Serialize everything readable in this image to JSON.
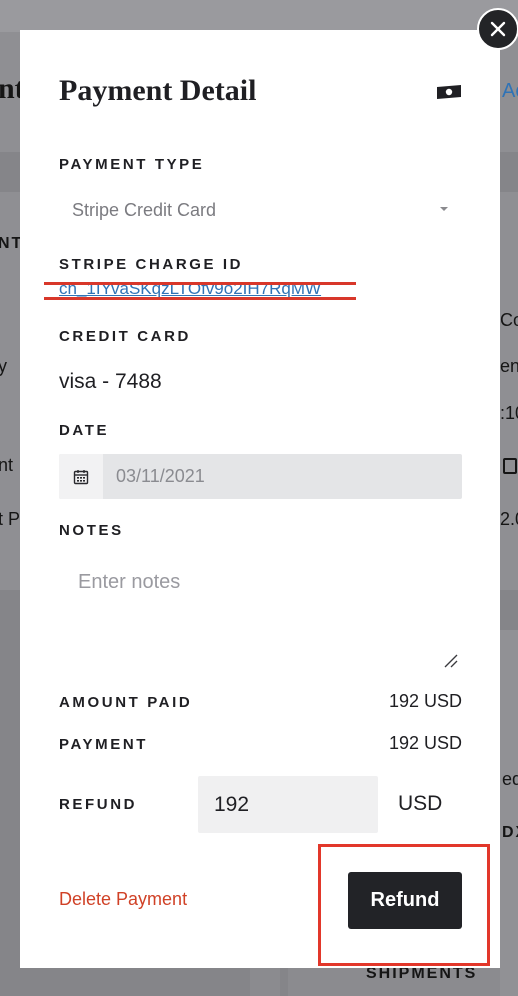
{
  "background": {
    "title_fragment": "nt",
    "link_fragment": "Ac",
    "left_fragments": [
      "NT",
      "y",
      "nt",
      "t P"
    ],
    "right_fragments": [
      "Co",
      "eni",
      ":10",
      "2.0",
      "ed",
      "DX"
    ],
    "bottom_label": "SHIPMENTS"
  },
  "modal": {
    "title": "Payment Detail",
    "title_icon": "cash-icon",
    "close_icon": "close-icon",
    "payment_type": {
      "label": "PAYMENT TYPE",
      "value": "Stripe Credit Card"
    },
    "stripe_charge": {
      "label": "STRIPE CHARGE ID",
      "value": "ch_1IYvaSKqzLTOfv9o2IH7RqMW"
    },
    "credit_card": {
      "label": "CREDIT CARD",
      "value": "visa - 7488"
    },
    "date": {
      "label": "DATE",
      "value": "03/11/2021",
      "icon": "calendar-icon"
    },
    "notes": {
      "label": "NOTES",
      "placeholder": "Enter notes"
    },
    "amount_paid": {
      "label": "AMOUNT PAID",
      "value": "192 USD"
    },
    "payment": {
      "label": "PAYMENT",
      "value": "192 USD"
    },
    "refund": {
      "label": "REFUND",
      "input_value": "192",
      "unit": "USD"
    },
    "actions": {
      "delete_label": "Delete Payment",
      "refund_label": "Refund"
    }
  },
  "colors": {
    "accent_dark": "#222327",
    "link_blue": "#2f73b6",
    "danger_red": "#d04126",
    "highlight_red": "#e2372a"
  }
}
